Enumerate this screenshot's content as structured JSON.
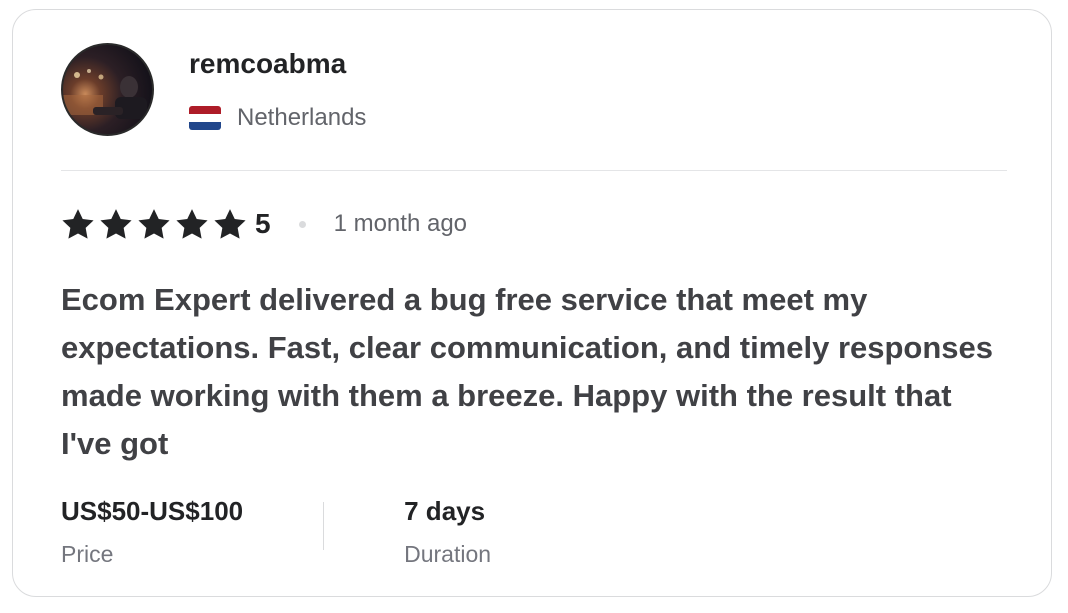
{
  "reviewer": {
    "username": "remcoabma",
    "country": "Netherlands",
    "flag_colors": [
      "#AE1C28",
      "#FFFFFF",
      "#21468B"
    ]
  },
  "rating": {
    "stars": 5,
    "value": "5",
    "time_ago": "1 month ago",
    "star_color": "#222325"
  },
  "review": {
    "text": "Ecom Expert delivered a bug free service that meet my expectations. Fast, clear communication, and timely responses made working with them a breeze. Happy with the result that I've got"
  },
  "meta": {
    "price_value": "US$50-US$100",
    "price_label": "Price",
    "duration_value": "7 days",
    "duration_label": "Duration"
  }
}
